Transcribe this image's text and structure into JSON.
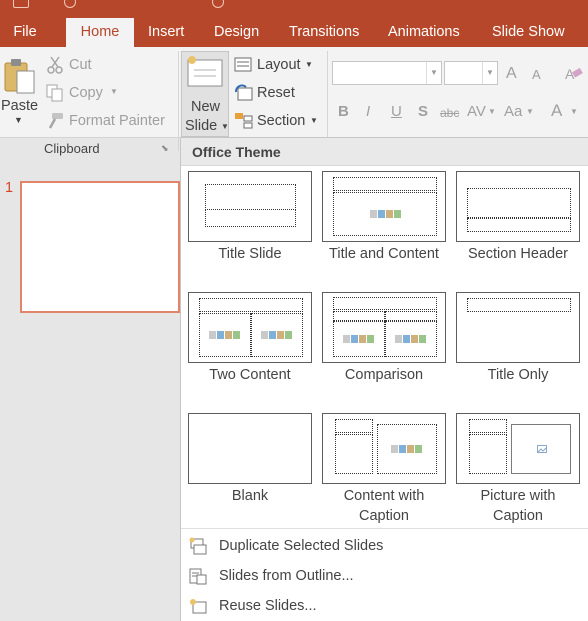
{
  "tabs": [
    "File",
    "Home",
    "Insert",
    "Design",
    "Transitions",
    "Animations",
    "Slide Show"
  ],
  "active_tab": "Home",
  "clipboard": {
    "paste_label": "Paste",
    "cut_label": "Cut",
    "copy_label": "Copy",
    "format_painter_label": "Format Painter",
    "group_label": "Clipboard"
  },
  "slides": {
    "new_slide_line1": "New",
    "new_slide_line2": "Slide",
    "layout_label": "Layout",
    "reset_label": "Reset",
    "section_label": "Section"
  },
  "font_group": {
    "bold": "B",
    "italic": "I",
    "underline": "U",
    "shadow": "S",
    "strikethrough": "abc",
    "char_spacing": "AV",
    "change_case": "Aa",
    "font_color": "A",
    "grow_font": "A",
    "shrink_font": "A"
  },
  "thumbnail": {
    "number": "1"
  },
  "gallery": {
    "header": "Office Theme",
    "layouts": [
      {
        "name_line1": "Title Slide",
        "name_line2": ""
      },
      {
        "name_line1": "Title and Content",
        "name_line2": ""
      },
      {
        "name_line1": "Section Header",
        "name_line2": ""
      },
      {
        "name_line1": "Two Content",
        "name_line2": ""
      },
      {
        "name_line1": "Comparison",
        "name_line2": ""
      },
      {
        "name_line1": "Title Only",
        "name_line2": ""
      },
      {
        "name_line1": "Blank",
        "name_line2": ""
      },
      {
        "name_line1": "Content with",
        "name_line2": "Caption"
      },
      {
        "name_line1": "Picture with",
        "name_line2": "Caption"
      }
    ],
    "menu": [
      {
        "label": "Duplicate Selected Slides",
        "icon": "duplicate-slides-icon"
      },
      {
        "label": "Slides from Outline...",
        "icon": "outline-slides-icon"
      },
      {
        "label": "Reuse Slides...",
        "icon": "reuse-slides-icon"
      }
    ]
  },
  "colors": {
    "accent": "#b7472a",
    "ribbon_bg": "#f3f3f3",
    "selected_thumb_border": "#e2846b"
  }
}
